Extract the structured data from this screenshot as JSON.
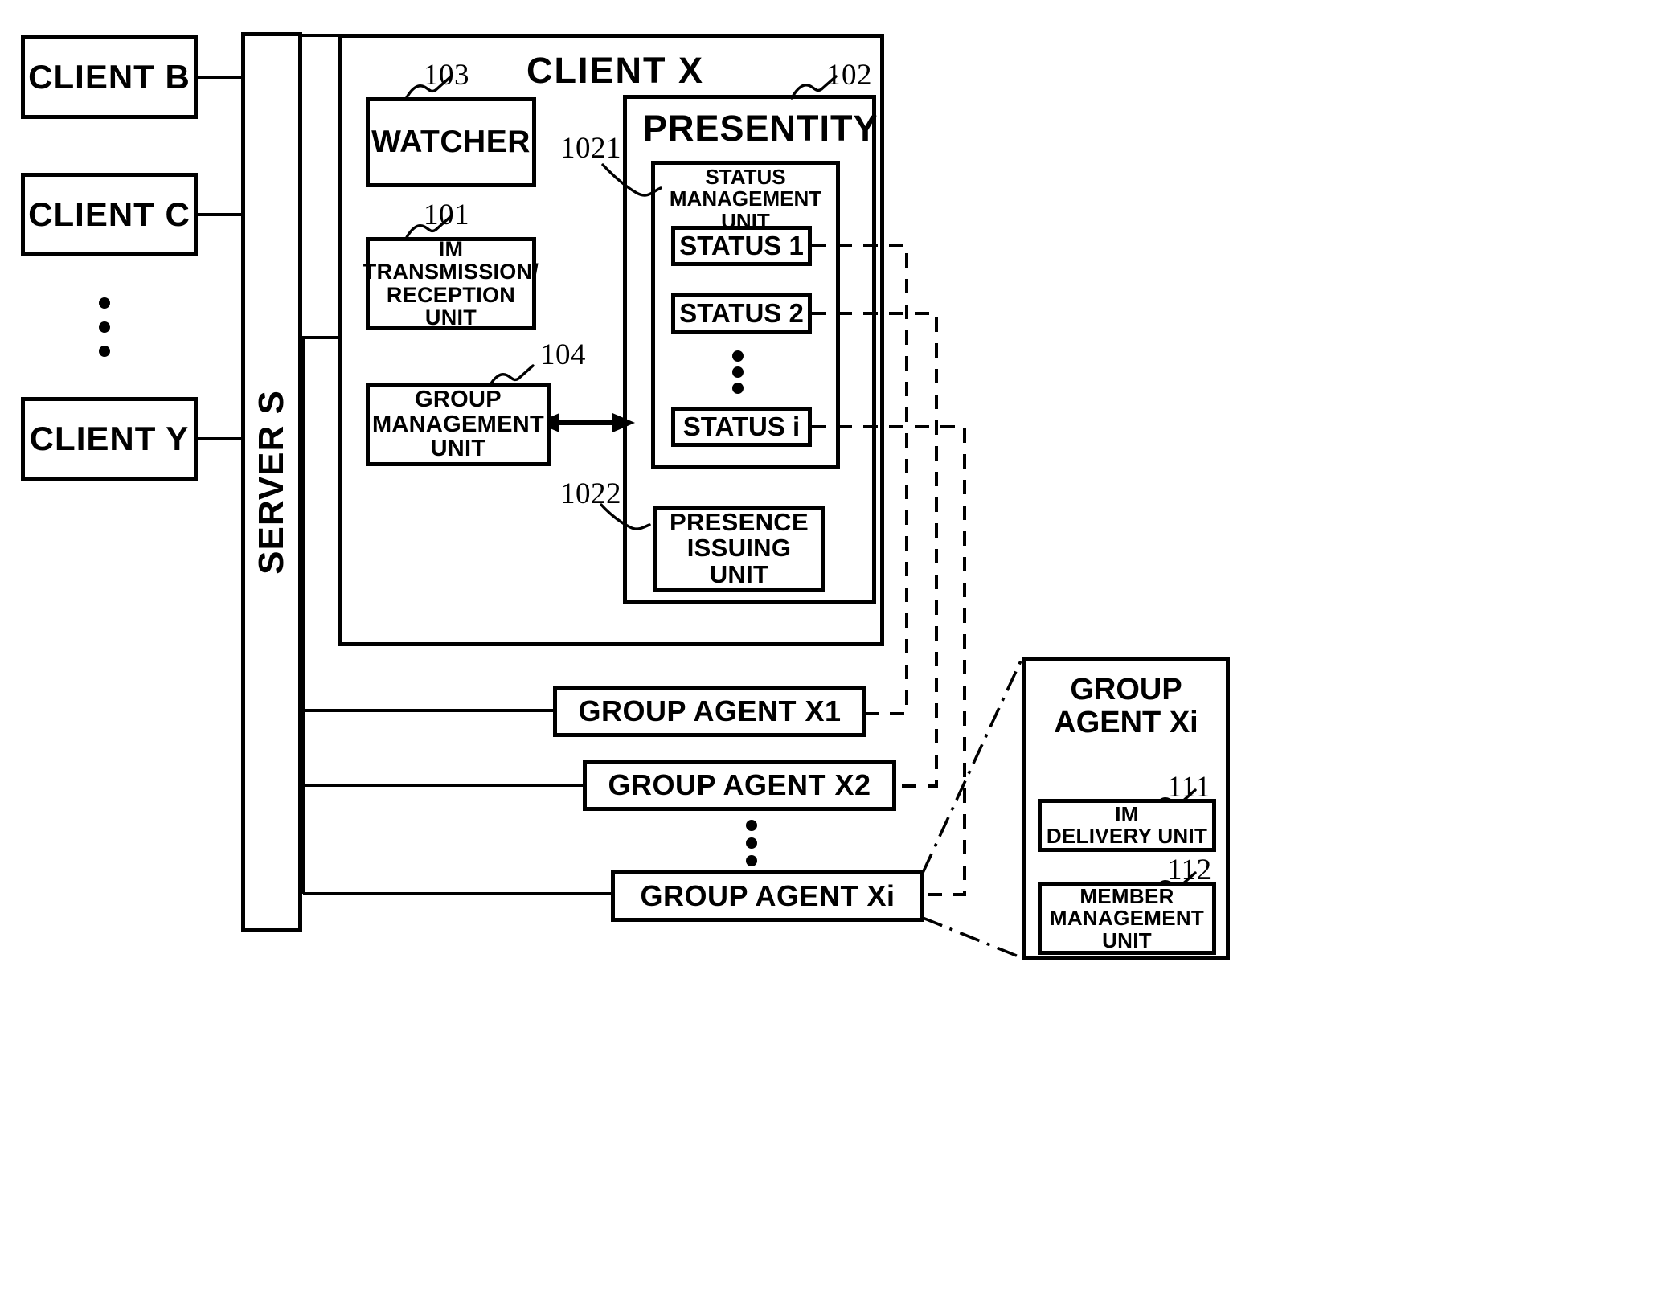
{
  "figure": {
    "type": "patent-block-diagram",
    "server": {
      "label": "SERVER S"
    },
    "clients": [
      {
        "label": "CLIENT B"
      },
      {
        "label": "CLIENT C"
      },
      {
        "label": "CLIENT Y"
      }
    ],
    "client_x": {
      "title": "CLIENT X",
      "watcher": {
        "label": "WATCHER",
        "ref": "103"
      },
      "im_unit": {
        "label": "IM\nTRANSMISSION/\nRECEPTION\nUNIT",
        "ref": "101"
      },
      "group_management_unit": {
        "label": "GROUP\nMANAGEMENT\nUNIT",
        "ref": "104"
      },
      "presentity": {
        "title": "PRESENTITY",
        "ref": "102",
        "status_management_unit": {
          "label": "STATUS\nMANAGEMENT\nUNIT",
          "ref": "1021",
          "statuses": [
            {
              "label": "STATUS 1"
            },
            {
              "label": "STATUS 2"
            },
            {
              "label": "STATUS i"
            }
          ]
        },
        "presence_issuing_unit": {
          "label": "PRESENCE\nISSUING\nUNIT",
          "ref": "1022"
        }
      }
    },
    "group_agents": [
      {
        "label": "GROUP AGENT X1"
      },
      {
        "label": "GROUP AGENT X2"
      },
      {
        "label": "GROUP AGENT Xi"
      }
    ],
    "group_agent_detail": {
      "title": "GROUP\nAGENT Xi",
      "units": [
        {
          "label": "IM\nDELIVERY UNIT",
          "ref": "111"
        },
        {
          "label": "MEMBER\nMANAGEMENT\nUNIT",
          "ref": "112"
        }
      ]
    }
  }
}
